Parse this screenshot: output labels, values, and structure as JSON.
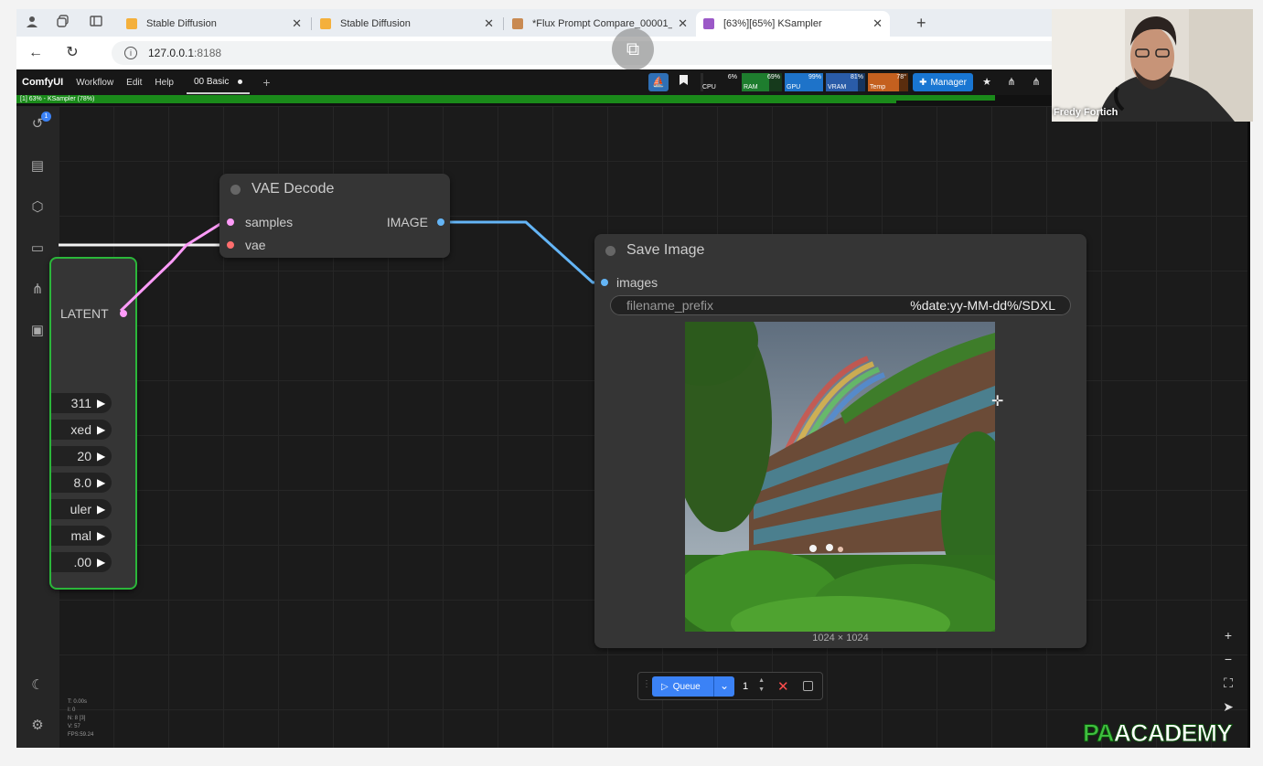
{
  "browser": {
    "tabs": [
      {
        "title": "Stable Diffusion",
        "favicon_color": "#f4b03c"
      },
      {
        "title": "Stable Diffusion",
        "favicon_color": "#f4b03c"
      },
      {
        "title": "*Flux Prompt Compare_00001_",
        "favicon_color": "#c98a52"
      },
      {
        "title": "[63%][65%] KSampler",
        "favicon_color": "#9b59c7"
      }
    ],
    "url_host": "127.0.0.1",
    "url_port": ":8188"
  },
  "comfy": {
    "brand": "ComfyUI",
    "menu": [
      "Workflow",
      "Edit",
      "Help"
    ],
    "workflow_tab": "00 Basic",
    "progress_text": "[1] 63% - KSampler (78%)",
    "progress_fraction": 0.63,
    "secondary_progress_fraction": 0.78,
    "monitors": [
      {
        "label": "CPU",
        "value": "6%",
        "fraction": 0.06,
        "color": "#2a2a2a"
      },
      {
        "label": "RAM",
        "value": "69%",
        "fraction": 0.69,
        "color": "#1e7d2e"
      },
      {
        "label": "GPU",
        "value": "99%",
        "fraction": 0.99,
        "color": "#1e73c9"
      },
      {
        "label": "VRAM",
        "value": "81%",
        "fraction": 0.81,
        "color": "#2a5ca8"
      },
      {
        "label": "Temp",
        "value": "78°",
        "fraction": 0.78,
        "color": "#c4601f"
      }
    ],
    "manager_label": "Manager",
    "sidebar_badge": "1",
    "stats": [
      "T: 0.00s",
      "I: 0",
      "N: 8 [3]",
      "V: 57",
      "FPS:59.24"
    ]
  },
  "nodes": {
    "vae_decode": {
      "title": "VAE Decode",
      "inputs": [
        "samples",
        "vae"
      ],
      "output": "IMAGE"
    },
    "save_image": {
      "title": "Save Image",
      "input": "images",
      "widget_label": "filename_prefix",
      "widget_value": "%date:yy-MM-dd%/SDXL",
      "image_size": "1024 × 1024"
    },
    "ksampler": {
      "output": "LATENT",
      "widgets": [
        "311",
        "xed",
        "20",
        "8.0",
        "uler",
        "mal",
        ".00"
      ]
    }
  },
  "queue": {
    "label": "Queue",
    "count": "1"
  },
  "webcam": {
    "name": "Fredy Fortich"
  },
  "watermark": {
    "part1": "PA",
    "part2": "ACADEMY"
  }
}
